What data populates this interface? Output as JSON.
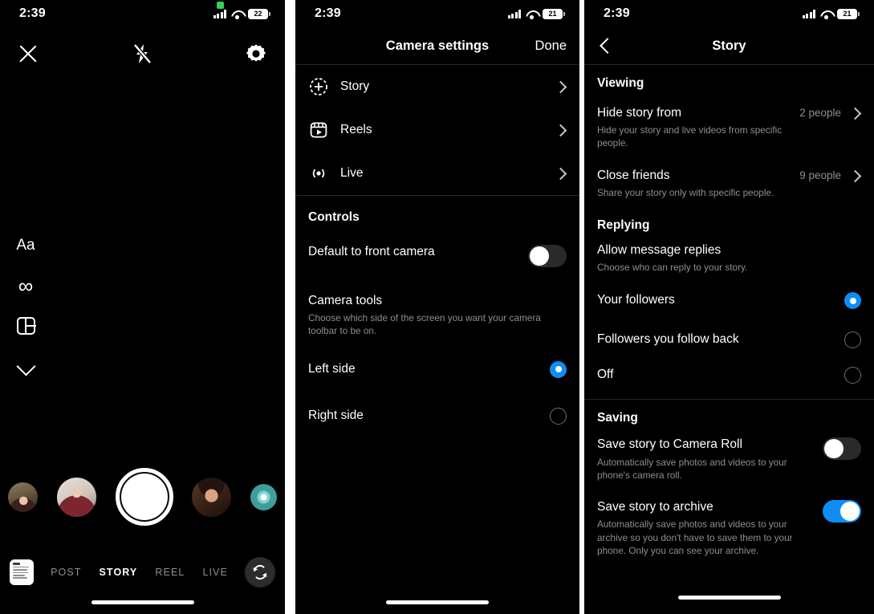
{
  "status_bar": {
    "time": "2:39",
    "battery_left": "22",
    "battery_mid": "21",
    "battery_right": "21"
  },
  "camera": {
    "close_label": "Close",
    "flash_label": "Flash off",
    "settings_label": "Camera settings",
    "tools": [
      {
        "name": "text-tool",
        "glyph": "Aa"
      },
      {
        "name": "boomerang-tool",
        "glyph": "∞"
      },
      {
        "name": "layout-tool",
        "glyph": "layout"
      },
      {
        "name": "more-tools",
        "glyph": "chevron-down"
      }
    ],
    "modes": [
      {
        "label": "POST",
        "active": false
      },
      {
        "label": "STORY",
        "active": true
      },
      {
        "label": "REEL",
        "active": false
      },
      {
        "label": "LIVE",
        "active": false
      }
    ],
    "shutter_label": "Capture",
    "gallery_label": "Gallery",
    "flip_label": "Flip camera"
  },
  "camera_settings": {
    "title": "Camera settings",
    "done_label": "Done",
    "items": [
      {
        "label": "Story",
        "icon": "story-plus-icon"
      },
      {
        "label": "Reels",
        "icon": "reels-icon"
      },
      {
        "label": "Live",
        "icon": "live-broadcast-icon"
      }
    ],
    "controls_head": "Controls",
    "front_camera": {
      "title": "Default to front camera",
      "on": false
    },
    "camera_tools": {
      "title": "Camera tools",
      "sub": "Choose which side of the screen you want your camera toolbar to be on."
    },
    "side_options": [
      {
        "label": "Left side",
        "selected": true
      },
      {
        "label": "Right side",
        "selected": false
      }
    ]
  },
  "story_settings": {
    "title": "Story",
    "back_label": "Back",
    "viewing_head": "Viewing",
    "viewing_items": [
      {
        "title": "Hide story from",
        "sub": "Hide your story and live videos from specific people.",
        "value": "2 people"
      },
      {
        "title": "Close friends",
        "sub": "Share your story only with specific people.",
        "value": "9 people"
      }
    ],
    "replying_head": "Replying",
    "replying_title": "Allow message replies",
    "replying_sub": "Choose who can reply to your story.",
    "reply_options": [
      {
        "label": "Your followers",
        "selected": true
      },
      {
        "label": "Followers you follow back",
        "selected": false
      },
      {
        "label": "Off",
        "selected": false
      }
    ],
    "saving_head": "Saving",
    "saving_items": [
      {
        "title": "Save story to Camera Roll",
        "sub": "Automatically save photos and videos to your phone's camera roll.",
        "on": false
      },
      {
        "title": "Save story to archive",
        "sub": "Automatically save photos and videos to your archive so you don't have to save them to your phone. Only you can see your archive.",
        "on": true
      }
    ]
  },
  "colors": {
    "accent_blue": "#0f8df5",
    "bg": "#000000",
    "secondary_text": "#8e8e93"
  }
}
